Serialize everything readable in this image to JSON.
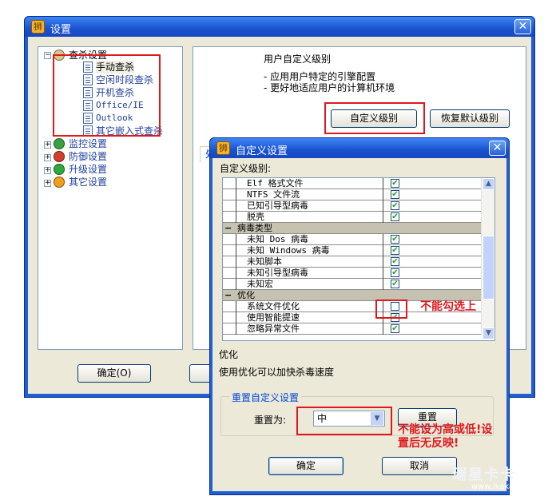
{
  "outer": {
    "title": "设置",
    "tree": [
      {
        "label": "查杀设置",
        "expanded": true
      },
      {
        "label": "手动查杀"
      },
      {
        "label": "空闲时段查杀"
      },
      {
        "label": "开机查杀"
      },
      {
        "label": "Office/IE"
      },
      {
        "label": "Outlook"
      },
      {
        "label": "其它嵌入式查杀"
      },
      {
        "label": "监控设置"
      },
      {
        "label": "防御设置"
      },
      {
        "label": "升级设置"
      },
      {
        "label": "其它设置"
      }
    ],
    "level_title": "用户自定义级别",
    "level_desc_1": "- 应用用户特定的引擎配置",
    "level_desc_2": "- 更好地适应用户的计算机环境",
    "custom_level_button": "自定义级别",
    "restore_default_button": "恢复默认级别",
    "ok_button": "确定(O)"
  },
  "inner": {
    "title": "自定义设置",
    "list_label": "自定义级别:",
    "rows": [
      {
        "type": "item",
        "name": "Elf 格式文件",
        "checked": true
      },
      {
        "type": "item",
        "name": "NTFS 文件流",
        "checked": true
      },
      {
        "type": "item",
        "name": "已知引导型病毒",
        "checked": true
      },
      {
        "type": "item",
        "name": "脱壳",
        "checked": true
      },
      {
        "type": "category",
        "name": "病毒类型"
      },
      {
        "type": "item",
        "name": "未知 Dos 病毒",
        "checked": true
      },
      {
        "type": "item",
        "name": "未知 Windows 病毒",
        "checked": true
      },
      {
        "type": "item",
        "name": "未知脚本",
        "checked": true
      },
      {
        "type": "item",
        "name": "未知引导型病毒",
        "checked": true
      },
      {
        "type": "item",
        "name": "未知宏",
        "checked": true
      },
      {
        "type": "category",
        "name": "优化"
      },
      {
        "type": "item",
        "name": "系统文件优化",
        "checked": false
      },
      {
        "type": "item",
        "name": "使用智能提速",
        "checked": true
      },
      {
        "type": "item",
        "name": "忽略异常文件",
        "checked": true
      }
    ],
    "desc_title": "优化",
    "desc_text": "使用优化可以加快杀毒速度",
    "reset_group": "重置自定义设置",
    "reset_to_label": "重置为:",
    "reset_select_value": "中",
    "reset_button": "重置",
    "ok_button": "确定",
    "cancel_button": "取消"
  },
  "annotations": {
    "cannot_check": "不能勾选上",
    "no_response_line1": "不能设为高或低!设",
    "no_response_line2": "置后无反映!"
  },
  "watermark": {
    "brand": "瑞星卡卡",
    "url": "www.ikaka.com"
  }
}
